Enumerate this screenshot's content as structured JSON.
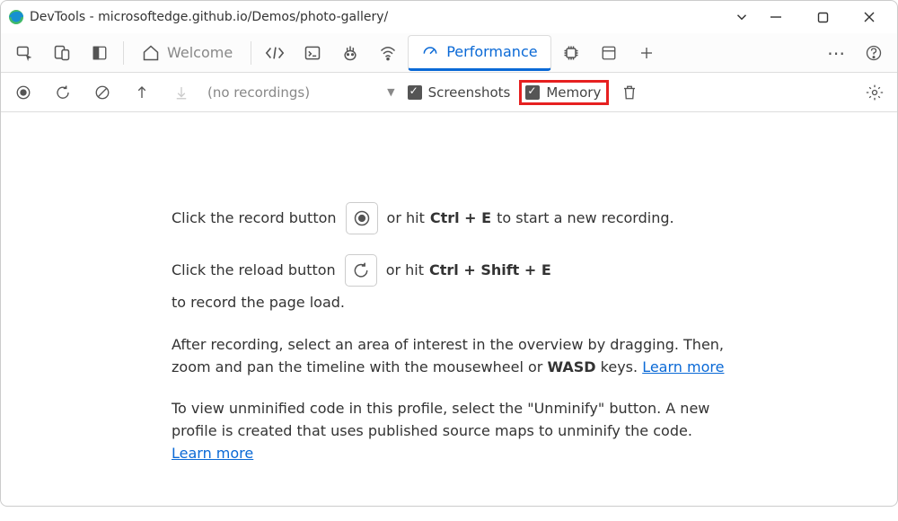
{
  "window": {
    "title": "DevTools - microsoftedge.github.io/Demos/photo-gallery/"
  },
  "tabs": {
    "welcome": "Welcome",
    "performance": "Performance"
  },
  "toolbar": {
    "no_recordings": "(no recordings)",
    "screenshots": "Screenshots",
    "memory": "Memory"
  },
  "instructions": {
    "line1_a": "Click the record button",
    "line1_b": "or hit",
    "line1_k": "Ctrl + E",
    "line1_c": "to start a new recording.",
    "line2_a": "Click the reload button",
    "line2_b": "or hit",
    "line2_k": "Ctrl + Shift + E",
    "line2_c": "to record the page load.",
    "line3_a": "After recording, select an area of interest in the overview by dragging. Then, zoom and pan the timeline with the mousewheel or ",
    "line3_k": "WASD",
    "line3_b": " keys. ",
    "learn_more": "Learn more",
    "line4_a": "To view unminified code in this profile, select the \"Unminify\" button. A new profile is created that uses published source maps to unminify the code. "
  }
}
